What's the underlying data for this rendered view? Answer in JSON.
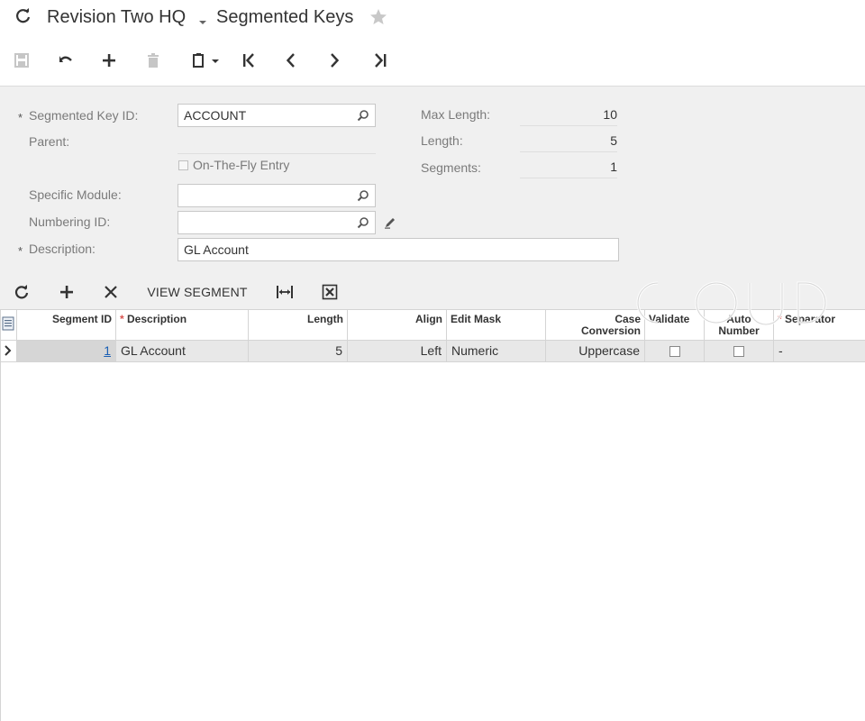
{
  "title": {
    "company": "Revision Two HQ",
    "screen": "Segmented Keys"
  },
  "toolbar": {
    "icons": [
      "save-icon",
      "undo-icon",
      "add-icon",
      "delete-icon",
      "clipboard-icon",
      "first-record-icon",
      "previous-record-icon",
      "next-record-icon",
      "last-record-icon"
    ]
  },
  "form": {
    "segmented_key_id_label": "Segmented Key ID:",
    "segmented_key_id_value": "ACCOUNT",
    "parent_label": "Parent:",
    "on_the_fly_label": "On-The-Fly Entry",
    "specific_module_label": "Specific Module:",
    "specific_module_value": "",
    "numbering_id_label": "Numbering ID:",
    "numbering_id_value": "",
    "description_label": "Description:",
    "description_value": "GL Account",
    "max_length_label": "Max Length:",
    "max_length_value": "10",
    "length_label": "Length:",
    "length_value": "5",
    "segments_label": "Segments:",
    "segments_value": "1",
    "required_mark": "*"
  },
  "grid_toolbar": {
    "view_segment_label": "VIEW SEGMENT"
  },
  "grid": {
    "headers": {
      "segment_id": "Segment ID",
      "description": "Description",
      "length": "Length",
      "align": "Align",
      "edit_mask": "Edit Mask",
      "case_conversion_1": "Case",
      "case_conversion_2": "Conversion",
      "validate": "Validate",
      "auto_number_1": "Auto",
      "auto_number_2": "Number",
      "separator": "Separator"
    },
    "rows": [
      {
        "segment_id": "1",
        "description": "GL Account",
        "length": "5",
        "align": "Left",
        "edit_mask": "Numeric",
        "case_conversion": "Uppercase",
        "validate": false,
        "auto_number": false,
        "separator": "-"
      }
    ]
  },
  "colors": {
    "required_star": "#d9534f",
    "link": "#1a5fb4",
    "form_bg": "#f0f0f0"
  }
}
